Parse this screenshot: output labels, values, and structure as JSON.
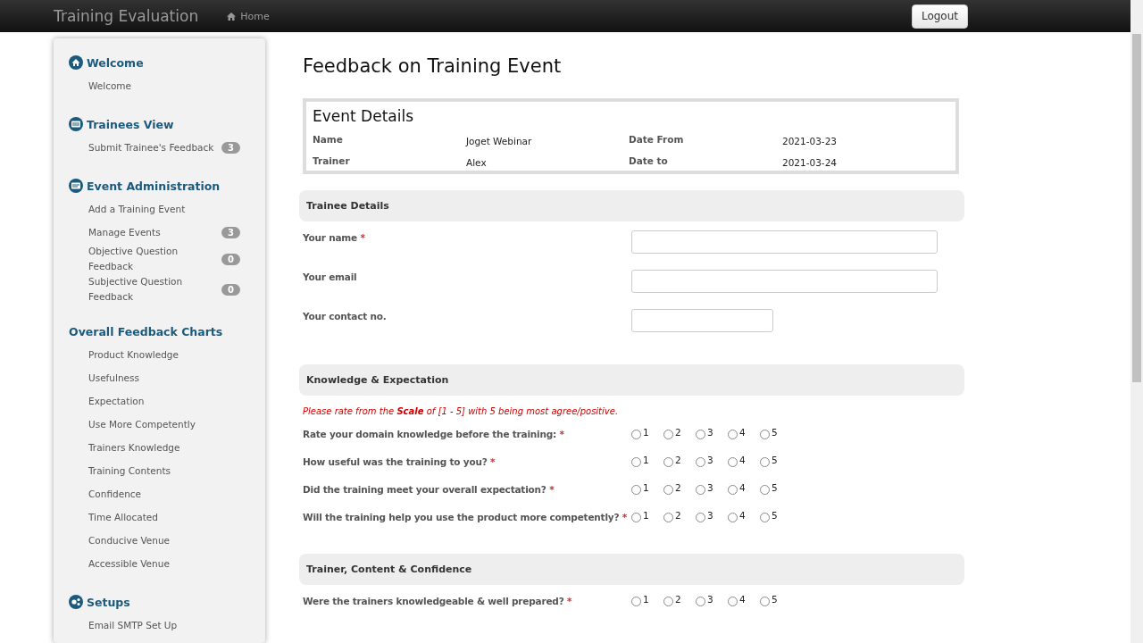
{
  "navbar": {
    "brand": "Training Evaluation",
    "links": [
      {
        "label": "Home"
      }
    ],
    "logout": "Logout"
  },
  "sidebar": {
    "sections": [
      {
        "kind": "home",
        "title": "Welcome",
        "items": [
          {
            "label": "Welcome"
          }
        ]
      },
      {
        "kind": "view",
        "title": "Trainees View",
        "items": [
          {
            "label": "Submit Trainee's Feedback",
            "badge": "3"
          }
        ]
      },
      {
        "kind": "admin",
        "title": "Event Administration",
        "items": [
          {
            "label": "Add a Training Event"
          },
          {
            "label": "Manage Events",
            "badge": "3"
          },
          {
            "label": "Objective Question Feedback",
            "badge": "0"
          },
          {
            "label": "Subjective Question Feedback",
            "badge": "0"
          }
        ]
      },
      {
        "kind": "charts",
        "title": "Overall Feedback Charts",
        "items": [
          {
            "label": "Product Knowledge"
          },
          {
            "label": "Usefulness"
          },
          {
            "label": "Expectation"
          },
          {
            "label": "Use More Competently"
          },
          {
            "label": "Trainers Knowledge"
          },
          {
            "label": "Training Contents"
          },
          {
            "label": "Confidence"
          },
          {
            "label": "Time Allocated"
          },
          {
            "label": "Conducive Venue"
          },
          {
            "label": "Accessible Venue"
          }
        ]
      },
      {
        "kind": "setup",
        "title": "Setups",
        "items": [
          {
            "label": "Email SMTP Set Up"
          }
        ]
      }
    ]
  },
  "page": {
    "title": "Feedback on Training Event"
  },
  "event_details": {
    "title": "Event Details",
    "fields": [
      {
        "label": "Name",
        "value": "Joget Webinar"
      },
      {
        "label": "Date From",
        "value": "2021-03-23"
      },
      {
        "label": "Trainer",
        "value": "Alex"
      },
      {
        "label": "Date to",
        "value": "2021-03-24"
      }
    ]
  },
  "sections": [
    {
      "title": "Trainee Details",
      "rows": [
        {
          "kind": "text",
          "label": "Your name",
          "required_mark": "*"
        },
        {
          "kind": "text",
          "label": "Your email"
        },
        {
          "kind": "number",
          "label": "Your contact no."
        }
      ]
    },
    {
      "title": "Knowledge & Expectation",
      "rows": [
        {
          "kind": "note",
          "text": "Please rate from the **Scale** of [1 - 5] with 5 being most agree/positive."
        },
        {
          "kind": "rating",
          "label": "Rate your domain knowledge before the training:",
          "required_mark": "*",
          "options": [
            {
              "label": "1",
              "selected": false
            },
            {
              "label": "2",
              "selected": false
            },
            {
              "label": "3",
              "selected": false
            },
            {
              "label": "4",
              "selected": false
            },
            {
              "label": "5",
              "selected": false
            }
          ]
        },
        {
          "kind": "rating",
          "label": "How useful was the training to you?",
          "required_mark": "*",
          "options": [
            {
              "label": "1",
              "selected": false
            },
            {
              "label": "2",
              "selected": false
            },
            {
              "label": "3",
              "selected": false
            },
            {
              "label": "4",
              "selected": false
            },
            {
              "label": "5",
              "selected": false
            }
          ]
        },
        {
          "kind": "rating",
          "label": "Did the training meet your overall expectation?",
          "required_mark": "*",
          "options": [
            {
              "label": "1",
              "selected": false
            },
            {
              "label": "2",
              "selected": false
            },
            {
              "label": "3",
              "selected": false
            },
            {
              "label": "4",
              "selected": false
            },
            {
              "label": "5",
              "selected": false
            }
          ]
        },
        {
          "kind": "rating",
          "label": "Will the training help you use the product more competently?",
          "required_mark": "*",
          "options": [
            {
              "label": "1",
              "selected": false
            },
            {
              "label": "2",
              "selected": false
            },
            {
              "label": "3",
              "selected": false
            },
            {
              "label": "4",
              "selected": false
            },
            {
              "label": "5",
              "selected": false
            }
          ]
        }
      ]
    },
    {
      "title": "Trainer, Content & Confidence",
      "rows": [
        {
          "kind": "rating",
          "label": "Were the trainers knowledgeable & well prepared?",
          "required_mark": "*",
          "options": [
            {
              "label": "1",
              "selected": false
            },
            {
              "label": "2",
              "selected": false
            },
            {
              "label": "3",
              "selected": false
            },
            {
              "label": "4",
              "selected": false
            },
            {
              "label": "5",
              "selected": false
            }
          ]
        }
      ]
    }
  ]
}
